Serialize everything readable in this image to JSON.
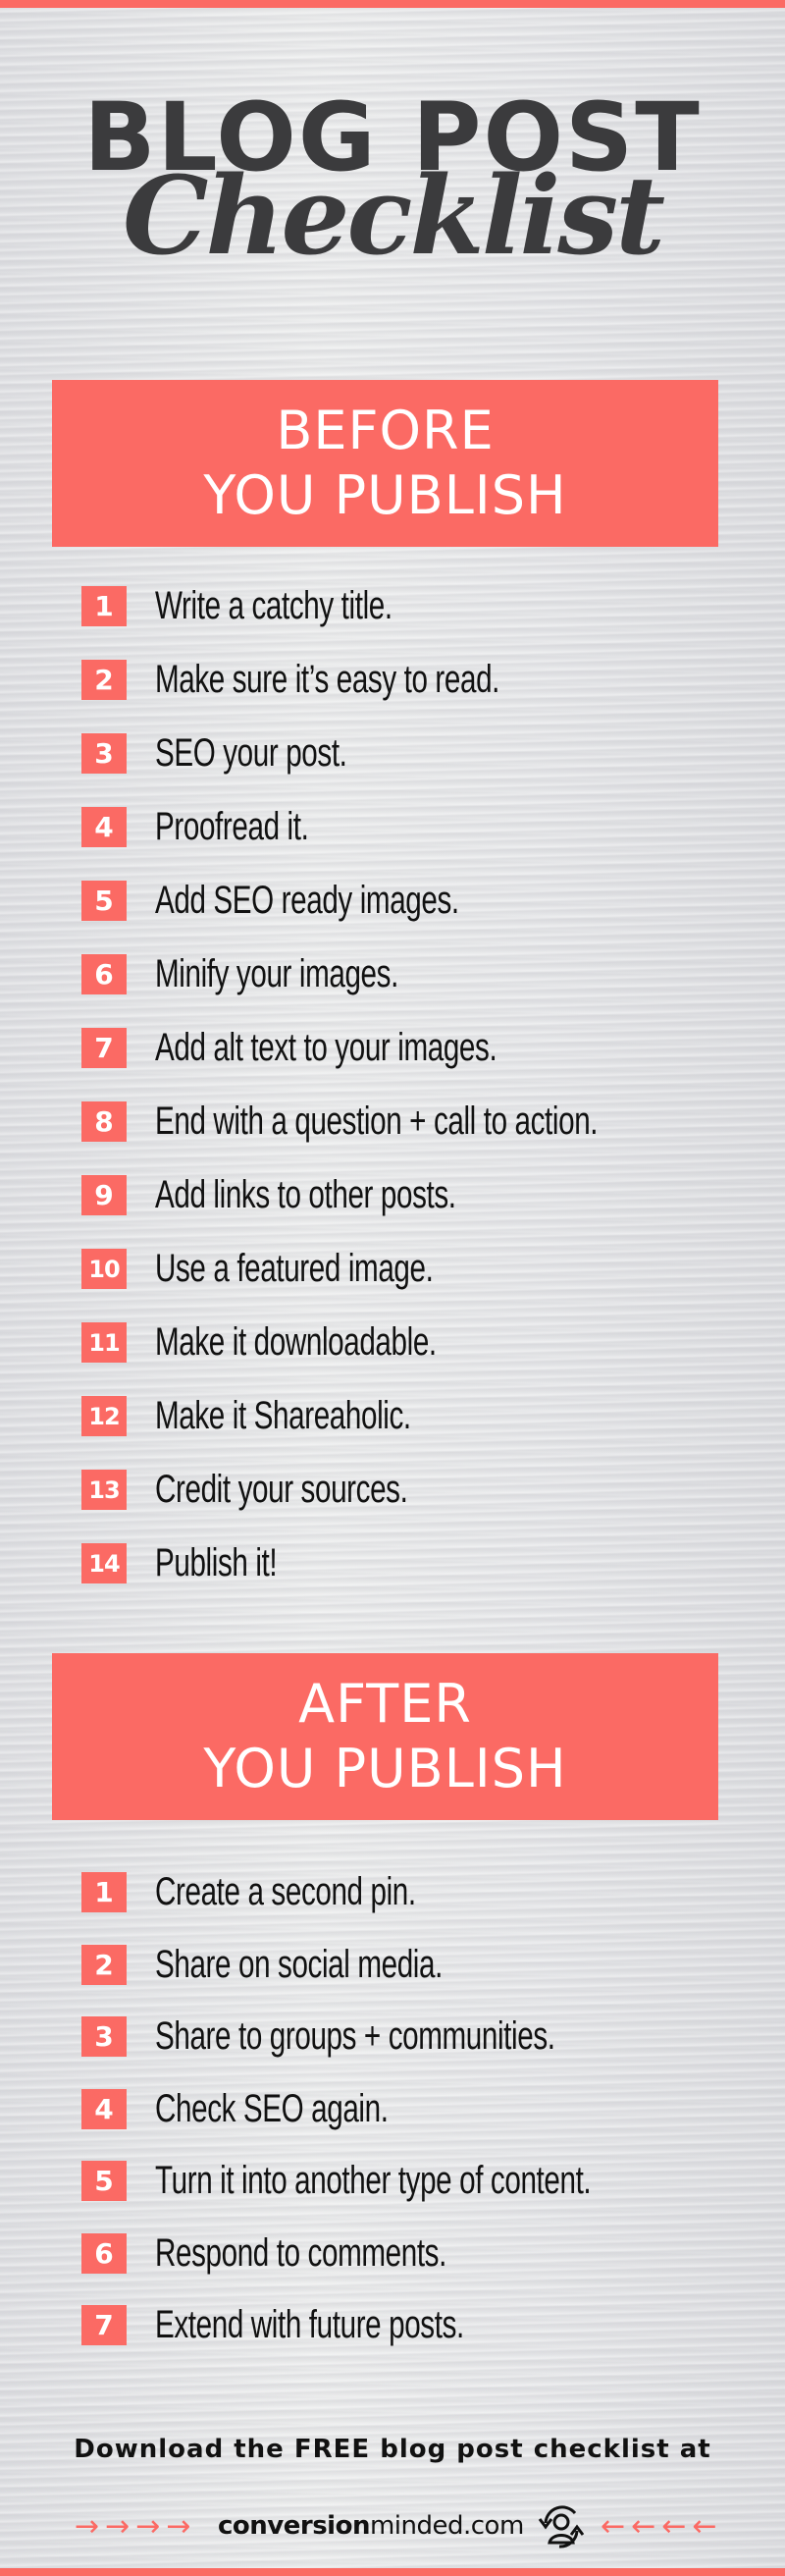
{
  "header": {
    "title_line1": "BLOG POST",
    "title_line2": "Checklist"
  },
  "colors": {
    "accent": "#fb6a64",
    "teal": "#3fc3cd",
    "dark_text": "#3b3b3d",
    "background": "#e4e5e7"
  },
  "before": {
    "heading_line1": "BEFORE",
    "heading_line2": "YOU PUBLISH",
    "items": [
      {
        "num": "1",
        "text": "Write a catchy title."
      },
      {
        "num": "2",
        "text": "Make sure it’s easy to read."
      },
      {
        "num": "3",
        "text": "SEO your post."
      },
      {
        "num": "4",
        "text": "Proofread it."
      },
      {
        "num": "5",
        "text": "Add SEO ready images."
      },
      {
        "num": "6",
        "text": "Minify your images."
      },
      {
        "num": "7",
        "text": "Add alt text to your images."
      },
      {
        "num": "8",
        "text": "End with a question + call to action."
      },
      {
        "num": "9",
        "text": "Add links to other posts."
      },
      {
        "num": "10",
        "text": "Use a featured image."
      },
      {
        "num": "11",
        "text": "Make it downloadable."
      },
      {
        "num": "12",
        "text": "Make it Shareaholic."
      },
      {
        "num": "13",
        "text": "Credit your sources."
      },
      {
        "num": "14",
        "text": "Publish it!"
      }
    ]
  },
  "after": {
    "heading_line1": "AFTER",
    "heading_line2": "YOU PUBLISH",
    "items": [
      {
        "num": "1",
        "text": "Create a second pin."
      },
      {
        "num": "2",
        "text": "Share on social media."
      },
      {
        "num": "3",
        "text": "Share to groups + communities."
      },
      {
        "num": "4",
        "text": "Check SEO again."
      },
      {
        "num": "5",
        "text": "Turn it into another type of content."
      },
      {
        "num": "6",
        "text": "Respond to comments."
      },
      {
        "num": "7",
        "text": "Extend with future posts."
      }
    ]
  },
  "footer": {
    "download_text": "Download the FREE blog post checklist at",
    "site_bold": "conversion",
    "site_regular": "minded.com",
    "arrows_right": "→→→→",
    "arrows_left": "←←←←",
    "logo_icon": "person-refresh-icon"
  }
}
